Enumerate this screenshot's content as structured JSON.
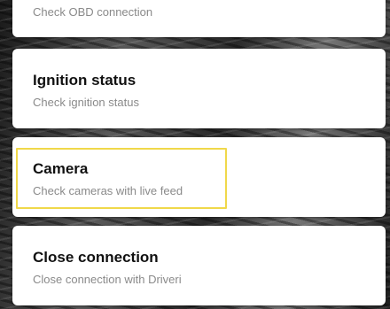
{
  "items": [
    {
      "title": "",
      "subtitle": "Check OBD connection"
    },
    {
      "title": "Ignition status",
      "subtitle": "Check ignition status"
    },
    {
      "title": "Camera",
      "subtitle": "Check cameras with live feed",
      "highlighted": true
    },
    {
      "title": "Close connection",
      "subtitle": "Close connection with Driveri"
    }
  ],
  "colors": {
    "highlight_border": "#f0d84a",
    "card_background": "#ffffff",
    "title_text": "#111111",
    "subtitle_text": "#8a8a8a"
  }
}
